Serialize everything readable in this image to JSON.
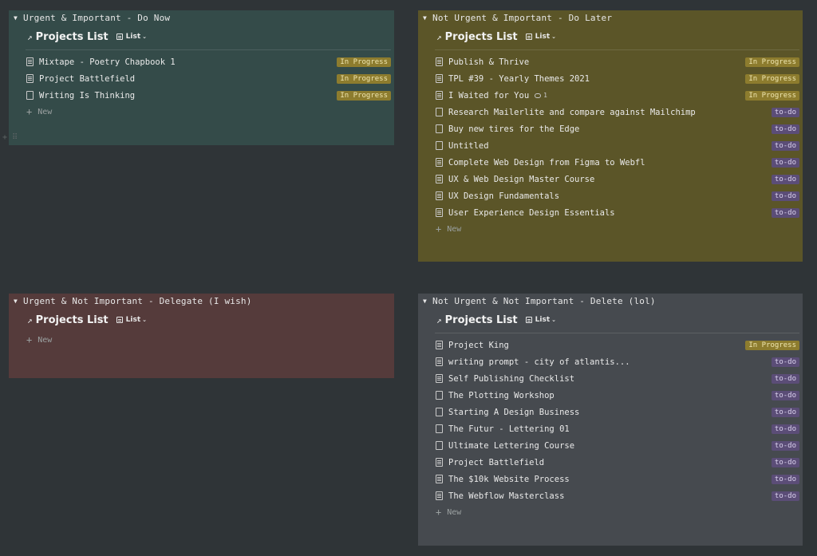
{
  "quadrants": [
    {
      "header": "Urgent & Important - Do Now",
      "db_title": "Projects List",
      "view_label": "List",
      "new_label": "New",
      "rows": [
        {
          "title": "Mixtape - Poetry Chapbook 1",
          "status": "In Progress"
        },
        {
          "title": "Project Battlefield",
          "status": "In Progress"
        },
        {
          "title": "Writing Is Thinking",
          "status": "In Progress"
        }
      ]
    },
    {
      "header": "Not Urgent & Important - Do Later",
      "db_title": "Projects List",
      "view_label": "List",
      "new_label": "New",
      "rows": [
        {
          "title": "Publish & Thrive",
          "status": "In Progress"
        },
        {
          "title": "TPL #39 - Yearly Themes 2021",
          "status": "In Progress"
        },
        {
          "title": "I Waited for You",
          "status": "In Progress",
          "comments": "1"
        },
        {
          "title": "Research Mailerlite and compare against Mailchimp",
          "status": "to-do"
        },
        {
          "title": "Buy new tires for the Edge",
          "status": "to-do"
        },
        {
          "title": "Untitled",
          "status": "to-do"
        },
        {
          "title": "Complete Web Design from Figma to Webfl",
          "status": "to-do"
        },
        {
          "title": "UX & Web Design Master Course",
          "status": "to-do"
        },
        {
          "title": "UX Design Fundamentals",
          "status": "to-do"
        },
        {
          "title": "User Experience Design Essentials",
          "status": "to-do"
        }
      ]
    },
    {
      "header": "Urgent & Not Important - Delegate (I wish)",
      "db_title": "Projects List",
      "view_label": "List",
      "new_label": "New",
      "rows": []
    },
    {
      "header": "Not Urgent & Not Important - Delete (lol)",
      "db_title": "Projects List",
      "view_label": "List",
      "new_label": "New",
      "rows": [
        {
          "title": "Project King",
          "status": "In Progress"
        },
        {
          "title": "writing prompt - city of atlantis...",
          "status": "to-do"
        },
        {
          "title": "Self Publishing Checklist",
          "status": "to-do"
        },
        {
          "title": "The Plotting Workshop",
          "status": "to-do"
        },
        {
          "title": "Starting A Design Business",
          "status": "to-do"
        },
        {
          "title": "The Futur - Lettering 01",
          "status": "to-do"
        },
        {
          "title": "Ultimate Lettering Course",
          "status": "to-do"
        },
        {
          "title": "Project Battlefield",
          "status": "to-do"
        },
        {
          "title": "The $10k Website Process",
          "status": "to-do"
        },
        {
          "title": "The Webflow Masterclass",
          "status": "to-do"
        }
      ]
    }
  ],
  "colors": {
    "background": "#2f3437",
    "do_now": "#344b49",
    "do_later": "#5b5528",
    "delegate": "#553b3b",
    "delete": "#464a4f",
    "in_progress_badge": "#8d7c2e",
    "todo_badge": "#5b4d77"
  }
}
